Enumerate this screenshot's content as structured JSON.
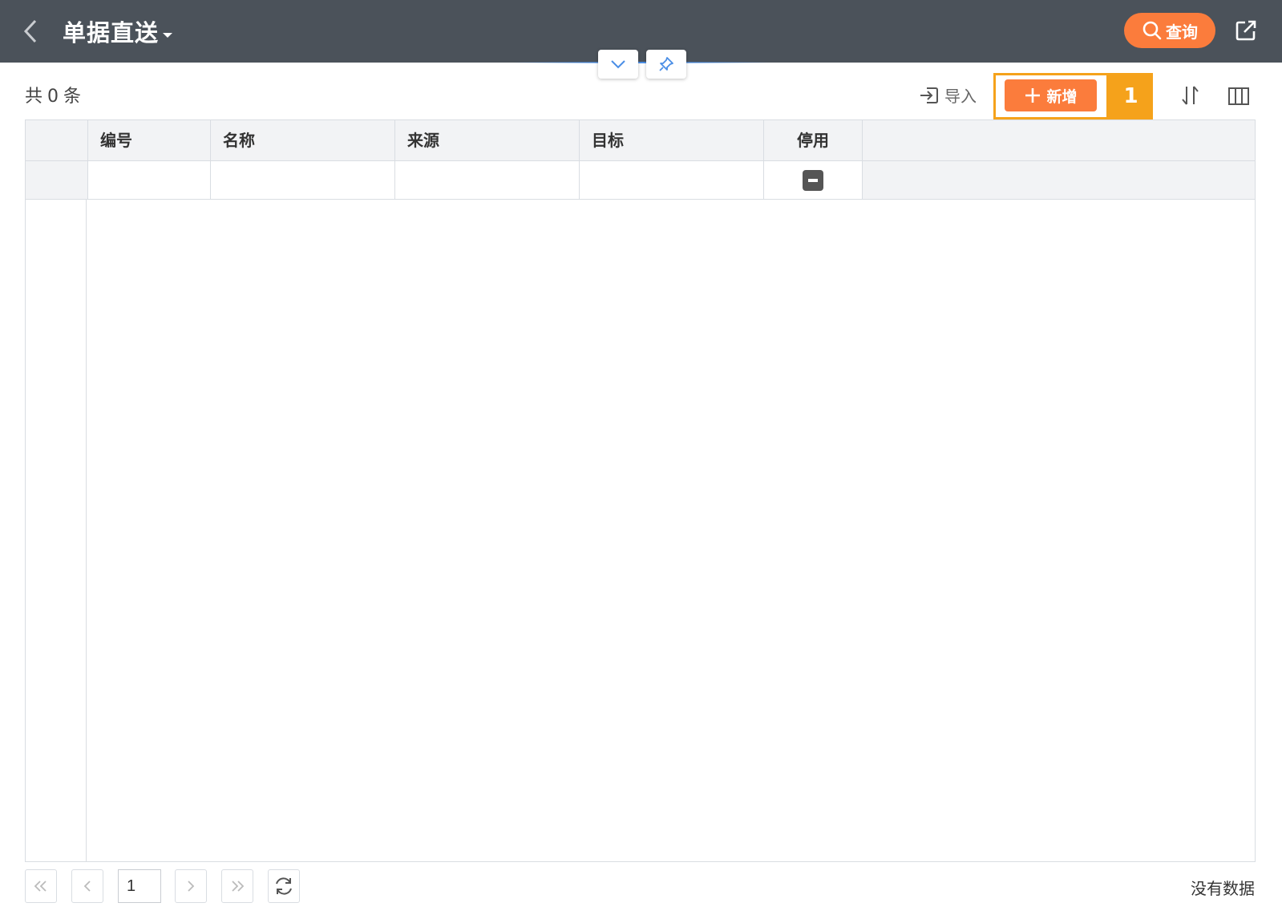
{
  "header": {
    "title": "单据直送",
    "query_label": "查询"
  },
  "toolbar": {
    "count_prefix": "共",
    "count_value": "0",
    "count_suffix": "条",
    "import_label": "导入",
    "add_label": "新增",
    "step_badge": "1"
  },
  "table": {
    "columns": [
      "编号",
      "名称",
      "来源",
      "目标",
      "停用"
    ]
  },
  "pager": {
    "current_page": "1",
    "status": "没有数据"
  },
  "colors": {
    "header_bg": "#4b525a",
    "accent": "#fb7c3c",
    "highlight": "#f5a21b"
  }
}
